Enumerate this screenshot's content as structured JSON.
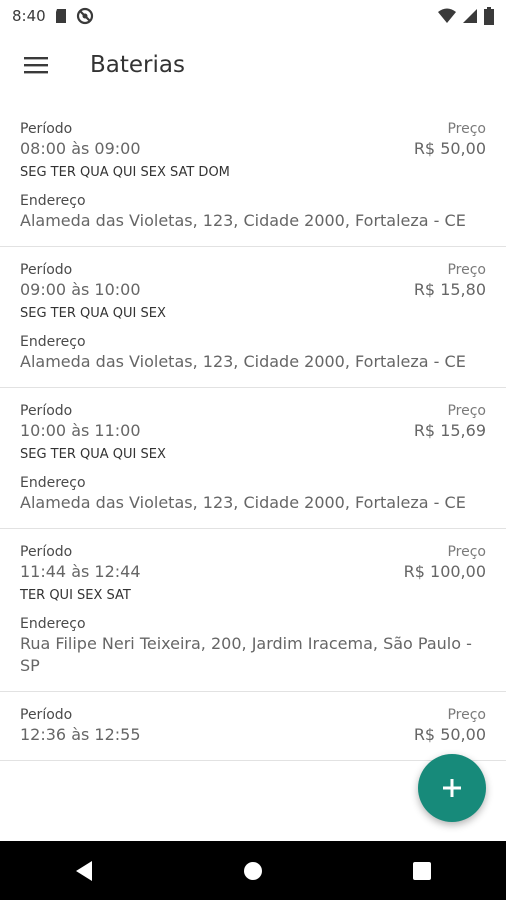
{
  "status": {
    "time": "8:40"
  },
  "app": {
    "title": "Baterias"
  },
  "labels": {
    "period": "Período",
    "price": "Preço",
    "address": "Endereço"
  },
  "items": [
    {
      "period": "08:00 às 09:00",
      "price": "R$ 50,00",
      "days": "SEG TER QUA QUI SEX SAT DOM",
      "address": "Alameda das Violetas, 123, Cidade 2000, Fortaleza - CE"
    },
    {
      "period": "09:00 às 10:00",
      "price": "R$ 15,80",
      "days": "SEG TER QUA QUI SEX",
      "address": "Alameda das Violetas, 123, Cidade 2000, Fortaleza - CE"
    },
    {
      "period": "10:00 às 11:00",
      "price": "R$ 15,69",
      "days": "SEG TER QUA QUI SEX",
      "address": "Alameda das Violetas, 123, Cidade 2000, Fortaleza - CE"
    },
    {
      "period": "11:44 às 12:44",
      "price": "R$ 100,00",
      "days": "TER QUI SEX SAT",
      "address": "Rua Filipe Neri Teixeira, 200, Jardim Iracema, São Paulo - SP"
    },
    {
      "period": "12:36 às 12:55",
      "price": "R$ 50,00"
    }
  ],
  "fab": {
    "icon": "plus-icon",
    "color": "#178a7a"
  },
  "nav": {
    "back_icon": "back-triangle-icon",
    "home_icon": "home-circle-icon",
    "recents_icon": "recents-square-icon"
  }
}
